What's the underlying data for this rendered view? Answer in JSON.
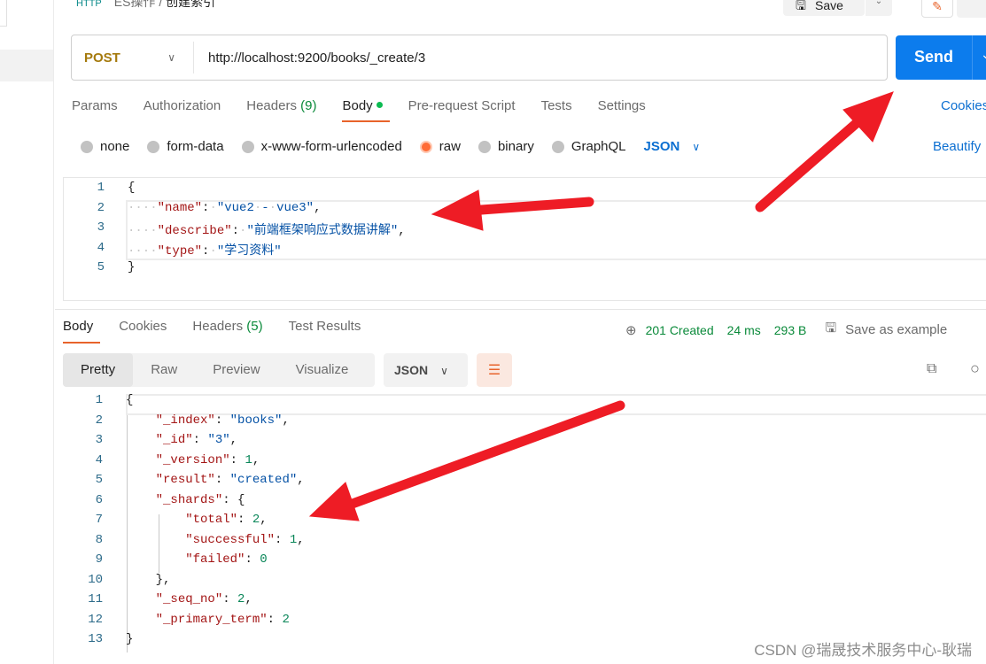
{
  "breadcrumb": {
    "collection": "ES操作",
    "separator": "/",
    "request": "创建索引",
    "icon": "http-icon",
    "icon_text": "HTTP"
  },
  "toolbar": {
    "save_label": "Save"
  },
  "request": {
    "method": "POST",
    "url": "http://localhost:9200/books/_create/3",
    "send_label": "Send",
    "tabs": [
      {
        "label": "Params"
      },
      {
        "label": "Authorization"
      },
      {
        "label": "Headers",
        "count": "(9)"
      },
      {
        "label": "Body",
        "active": true
      },
      {
        "label": "Pre-request Script"
      },
      {
        "label": "Tests"
      },
      {
        "label": "Settings"
      }
    ],
    "cookies_label": "Cookies",
    "body_types": [
      {
        "label": "none"
      },
      {
        "label": "form-data"
      },
      {
        "label": "x-www-form-urlencoded"
      },
      {
        "label": "raw",
        "selected": true
      },
      {
        "label": "binary"
      },
      {
        "label": "GraphQL"
      }
    ],
    "raw_format": "JSON",
    "beautify_label": "Beautify",
    "body_lines": [
      [
        [
          "p",
          "{"
        ]
      ],
      [
        [
          "ws",
          "····"
        ],
        [
          "k",
          "\"name\""
        ],
        [
          "p",
          ":"
        ],
        [
          "ws",
          "·"
        ],
        [
          "s",
          "\"vue2"
        ],
        [
          "ws",
          "·"
        ],
        [
          "s",
          "-"
        ],
        [
          "ws",
          "·"
        ],
        [
          "s",
          "vue3\""
        ],
        [
          "p",
          ","
        ]
      ],
      [
        [
          "ws",
          "····"
        ],
        [
          "k",
          "\"describe\""
        ],
        [
          "p",
          ":"
        ],
        [
          "ws",
          "·"
        ],
        [
          "s",
          "\"前端框架响应式数据讲解\""
        ],
        [
          "p",
          ","
        ]
      ],
      [
        [
          "ws",
          "····"
        ],
        [
          "k",
          "\"type\""
        ],
        [
          "p",
          ":"
        ],
        [
          "ws",
          "·"
        ],
        [
          "s",
          "\"学习资料\""
        ]
      ],
      [
        [
          "p",
          "}"
        ]
      ]
    ]
  },
  "response": {
    "tabs": [
      {
        "label": "Body",
        "active": true
      },
      {
        "label": "Cookies"
      },
      {
        "label": "Headers",
        "count": "(5)"
      },
      {
        "label": "Test Results"
      }
    ],
    "status": "201 Created",
    "time": "24 ms",
    "size": "293 B",
    "save_example_label": "Save as example",
    "views": [
      {
        "label": "Pretty",
        "active": true
      },
      {
        "label": "Raw"
      },
      {
        "label": "Preview"
      },
      {
        "label": "Visualize"
      }
    ],
    "format": "JSON",
    "body_lines": [
      [
        [
          "p",
          "{"
        ]
      ],
      [
        [
          "p",
          "    "
        ],
        [
          "k",
          "\"_index\""
        ],
        [
          "p",
          ": "
        ],
        [
          "s",
          "\"books\""
        ],
        [
          "p",
          ","
        ]
      ],
      [
        [
          "p",
          "    "
        ],
        [
          "k",
          "\"_id\""
        ],
        [
          "p",
          ": "
        ],
        [
          "s",
          "\"3\""
        ],
        [
          "p",
          ","
        ]
      ],
      [
        [
          "p",
          "    "
        ],
        [
          "k",
          "\"_version\""
        ],
        [
          "p",
          ": "
        ],
        [
          "n",
          "1"
        ],
        [
          "p",
          ","
        ]
      ],
      [
        [
          "p",
          "    "
        ],
        [
          "k",
          "\"result\""
        ],
        [
          "p",
          ": "
        ],
        [
          "s",
          "\"created\""
        ],
        [
          "p",
          ","
        ]
      ],
      [
        [
          "p",
          "    "
        ],
        [
          "k",
          "\"_shards\""
        ],
        [
          "p",
          ": {"
        ]
      ],
      [
        [
          "p",
          "        "
        ],
        [
          "k",
          "\"total\""
        ],
        [
          "p",
          ": "
        ],
        [
          "n",
          "2"
        ],
        [
          "p",
          ","
        ]
      ],
      [
        [
          "p",
          "        "
        ],
        [
          "k",
          "\"successful\""
        ],
        [
          "p",
          ": "
        ],
        [
          "n",
          "1"
        ],
        [
          "p",
          ","
        ]
      ],
      [
        [
          "p",
          "        "
        ],
        [
          "k",
          "\"failed\""
        ],
        [
          "p",
          ": "
        ],
        [
          "n",
          "0"
        ]
      ],
      [
        [
          "p",
          "    },"
        ]
      ],
      [
        [
          "p",
          "    "
        ],
        [
          "k",
          "\"_seq_no\""
        ],
        [
          "p",
          ": "
        ],
        [
          "n",
          "2"
        ],
        [
          "p",
          ","
        ]
      ],
      [
        [
          "p",
          "    "
        ],
        [
          "k",
          "\"_primary_term\""
        ],
        [
          "p",
          ": "
        ],
        [
          "n",
          "2"
        ]
      ],
      [
        [
          "p",
          "}"
        ]
      ]
    ]
  },
  "colors": {
    "accent": "#ff6c37",
    "send": "#0c7ced",
    "annotation_arrow": "#ee1c25",
    "status": "#0a8a3a"
  },
  "watermark": "CSDN @瑞晟技术服务中心-耿瑞"
}
